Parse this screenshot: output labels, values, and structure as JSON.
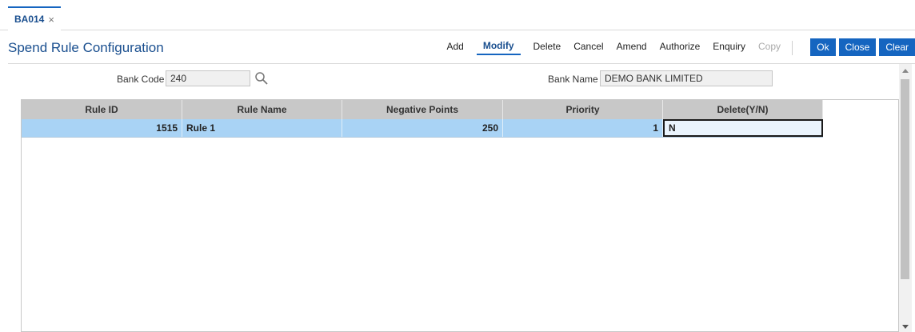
{
  "tab": {
    "label": "BA014",
    "close_glyph": "×"
  },
  "header": {
    "title": "Spend Rule Configuration",
    "actions": [
      {
        "label": "Add",
        "state": "normal"
      },
      {
        "label": "Modify",
        "state": "active"
      },
      {
        "label": "Delete",
        "state": "normal"
      },
      {
        "label": "Cancel",
        "state": "normal"
      },
      {
        "label": "Amend",
        "state": "normal"
      },
      {
        "label": "Authorize",
        "state": "normal"
      },
      {
        "label": "Enquiry",
        "state": "normal"
      },
      {
        "label": "Copy",
        "state": "disabled"
      }
    ],
    "buttons": {
      "ok": "Ok",
      "close": "Close",
      "clear": "Clear"
    }
  },
  "form": {
    "bank_code_label": "Bank Code",
    "bank_code_value": "240",
    "bank_name_label": "Bank Name",
    "bank_name_value": "DEMO BANK LIMITED"
  },
  "grid": {
    "columns": [
      "Rule ID",
      "Rule Name",
      "Negative Points",
      "Priority",
      "Delete(Y/N)"
    ],
    "rows": [
      {
        "rule_id": "1515",
        "rule_name": "Rule 1",
        "negative_points": "250",
        "priority": "1",
        "delete": "N"
      }
    ]
  },
  "icons": {
    "search": "search-icon",
    "close": "close-icon",
    "scroll_up": "chevron-up-icon",
    "scroll_down": "chevron-down-icon"
  },
  "colors": {
    "accent": "#1565c0",
    "title": "#1a4f8f",
    "header_bg": "#c8c8c8",
    "selected_row": "#a9d3f5"
  }
}
